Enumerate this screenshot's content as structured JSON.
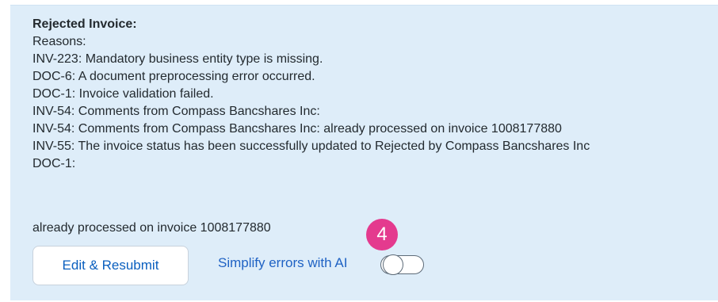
{
  "message": {
    "title": "Rejected Invoice:",
    "lines": [
      "Reasons:",
      "INV-223: Mandatory business entity type is missing.",
      "DOC-6: A document preprocessing error occurred.",
      "DOC-1: Invoice validation failed.",
      "INV-54: Comments from Compass Bancshares Inc:",
      "INV-54: Comments from Compass Bancshares Inc: already processed on invoice 1008177880",
      "INV-55: The invoice status has been successfully updated to Rejected by Compass Bancshares Inc",
      "DOC-1:"
    ],
    "footer": "already processed on invoice 1008177880"
  },
  "actions": {
    "edit_resubmit_label": "Edit & Resubmit",
    "simplify_label": "Simplify errors with AI",
    "simplify_enabled": false
  },
  "annotation": {
    "step_number": "4",
    "color": "#e43a8e"
  },
  "colors": {
    "panel_background": "#deedf9",
    "link_blue": "#1f62c4",
    "button_text": "#0a5fbf"
  }
}
